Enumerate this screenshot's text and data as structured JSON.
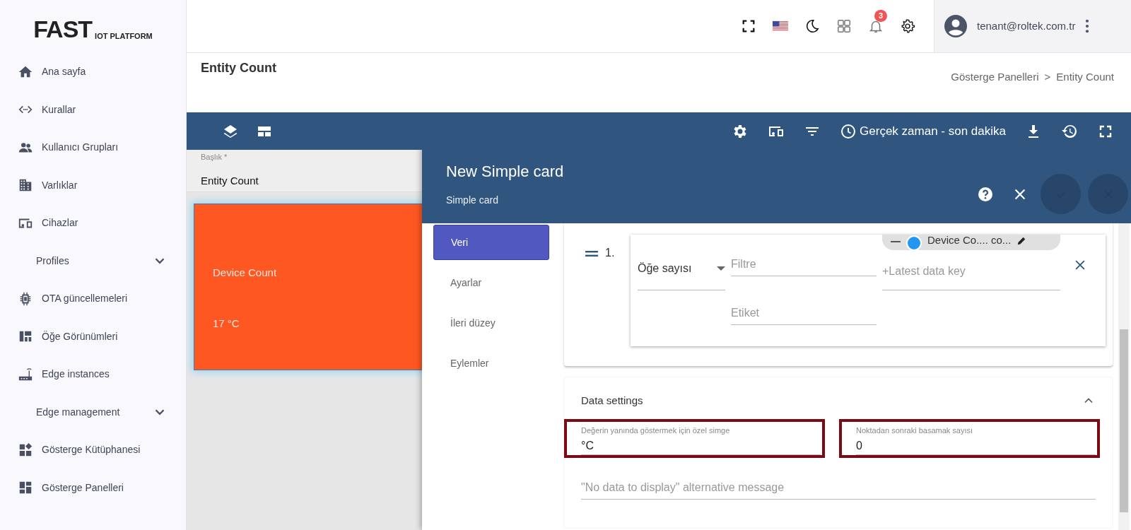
{
  "logo": {
    "main": "FAST",
    "sub": "IOT PLATFORM"
  },
  "sidebar": {
    "items": [
      {
        "label": "Ana sayfa",
        "kind": "link"
      },
      {
        "label": "Kurallar",
        "kind": "link"
      },
      {
        "label": "Kullanıcı Grupları",
        "kind": "link"
      },
      {
        "label": "Varlıklar",
        "kind": "link"
      },
      {
        "label": "Cihazlar",
        "kind": "link"
      },
      {
        "label": "Profiles",
        "kind": "group",
        "expanded": false
      },
      {
        "label": "OTA güncellemeleri",
        "kind": "link"
      },
      {
        "label": "Öğe Görünümleri",
        "kind": "link"
      },
      {
        "label": "Edge instances",
        "kind": "link"
      },
      {
        "label": "Edge management",
        "kind": "group",
        "expanded": false
      },
      {
        "label": "Gösterge Kütüphanesi",
        "kind": "link"
      },
      {
        "label": "Gösterge Panelleri",
        "kind": "link"
      }
    ]
  },
  "topbar": {
    "notifications": "3",
    "user": "tenant@roltek.com.tr"
  },
  "page": {
    "title": "Entity Count",
    "breadcrumb": [
      "Gösterge Panelleri",
      "Entity Count"
    ],
    "separator": ">"
  },
  "toolbar": {
    "timewindow": "Gerçek zaman - son dakika"
  },
  "title_field": {
    "label": "Başlık *",
    "value": "Entity Count"
  },
  "widget": {
    "label": "Device Count",
    "value": "17 °C"
  },
  "dialog": {
    "title": "New Simple card",
    "subtitle": "Simple card",
    "tabs": [
      {
        "label": "Veri",
        "selected": true
      },
      {
        "label": "Ayarlar",
        "selected": false
      },
      {
        "label": "İleri düzey",
        "selected": false
      },
      {
        "label": "Eylemler",
        "selected": false
      }
    ]
  },
  "datasource": {
    "index": "1.",
    "type": "Öğe sayısı",
    "filter_placeholder": "Filtre",
    "label_placeholder": "Etiket",
    "chip": "Device Co.... co...",
    "key_placeholder": "+Latest data key"
  },
  "data_settings": {
    "title": "Data settings",
    "expanded": true,
    "fields": [
      {
        "label": "Değerin yanında göstermek için özel simge",
        "value": "°C",
        "highlighted": true
      },
      {
        "label": "Noktadan sonraki basamak sayısı",
        "value": "0",
        "highlighted": true
      }
    ],
    "message_placeholder": "\"No data to display\" alternative message"
  }
}
